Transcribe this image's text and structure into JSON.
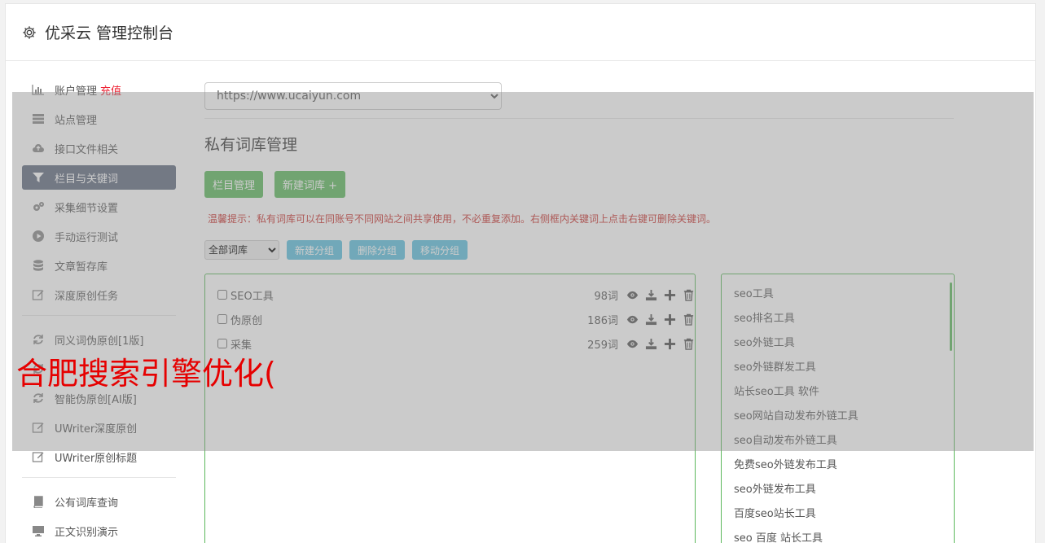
{
  "header": {
    "title": "优采云 管理控制台"
  },
  "sidebar": {
    "group1": [
      {
        "label": "账户管理",
        "icon": "bar-chart-icon",
        "extra": "充值"
      },
      {
        "label": "站点管理",
        "icon": "server-icon"
      },
      {
        "label": "接口文件相关",
        "icon": "cloud-upload-icon"
      },
      {
        "label": "栏目与关键词",
        "icon": "filter-icon",
        "active": true
      },
      {
        "label": "采集细节设置",
        "icon": "gears-icon"
      },
      {
        "label": "手动运行测试",
        "icon": "play-circle-icon"
      },
      {
        "label": "文章暂存库",
        "icon": "database-icon"
      },
      {
        "label": "深度原创任务",
        "icon": "edit-icon"
      }
    ],
    "group2": [
      {
        "label": "同义词伪原创[1版]",
        "icon": "refresh-icon"
      },
      {
        "label": "",
        "icon": "refresh-icon"
      },
      {
        "label": "智能伪原创[AI版]",
        "icon": "refresh-icon"
      },
      {
        "label": "UWriter深度原创",
        "icon": "edit-icon"
      },
      {
        "label": "UWriter原创标题",
        "icon": "edit-icon"
      }
    ],
    "group3": [
      {
        "label": "公有词库查询",
        "icon": "book-icon"
      },
      {
        "label": "正文识别演示",
        "icon": "monitor-icon"
      }
    ]
  },
  "main": {
    "site_select": "https://www.ucaiyun.com",
    "section_title": "私有词库管理",
    "btn_column": "栏目管理",
    "btn_new_lib": "新建词库 +",
    "tip": "温馨提示：私有词库可以在同账号不同网站之间共享使用，不必重复添加。右侧框内关键词上点击右键可删除关键词。",
    "group_select": "全部词库",
    "btn_new_group": "新建分组",
    "btn_del_group": "删除分组",
    "btn_move_group": "移动分组",
    "libraries": [
      {
        "name": "SEO工具",
        "count": "98词"
      },
      {
        "name": "伪原创",
        "count": "186词"
      },
      {
        "name": "采集",
        "count": "259词"
      }
    ],
    "keywords": [
      "seo工具",
      "seo排名工具",
      "seo外链工具",
      "seo外链群发工具",
      "站长seo工具 软件",
      "seo网站自动发布外链工具",
      "seo自动发布外链工具",
      "免费seo外链发布工具",
      "seo外链发布工具",
      "百度seo站长工具",
      "seo 百度 站长工具"
    ]
  },
  "watermark": "合肥搜索引擎优化(",
  "colors": {
    "accent_green": "#5cb85c",
    "accent_blue": "#5bc0de",
    "sidebar_active": "#5f6b7f",
    "tip_red": "#c9302c"
  }
}
